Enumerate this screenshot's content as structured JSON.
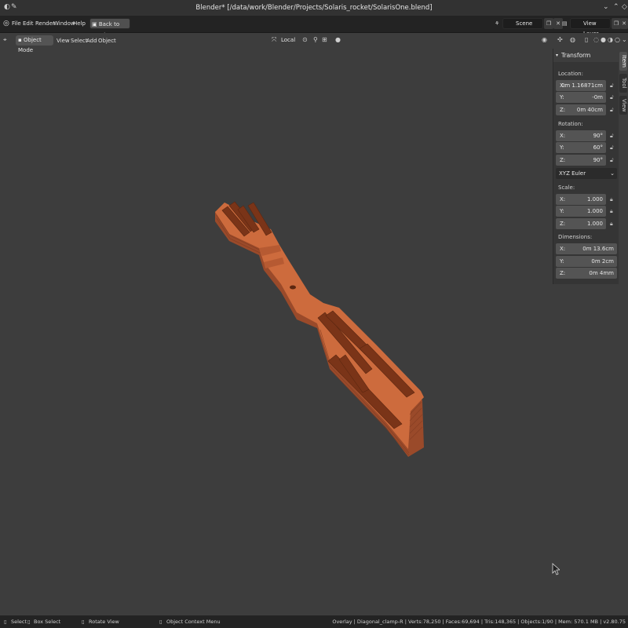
{
  "window": {
    "title": "Blender* [/data/work/Blender/Projects/Solaris_rocket/SolarisOne.blend]"
  },
  "menubar": {
    "items": [
      "File",
      "Edit",
      "Render",
      "Window",
      "Help"
    ],
    "back_button": "Back to Previous",
    "scene": "Scene",
    "view_layer": "View Layer"
  },
  "viewport_header": {
    "mode": "Object Mode",
    "menus": [
      "View",
      "Select",
      "Add",
      "Object"
    ],
    "orientation": "Local"
  },
  "side_tabs": [
    "Item",
    "Tool",
    "View"
  ],
  "transform_panel": {
    "title": "Transform",
    "location_label": "Location:",
    "location": [
      {
        "axis": "X:",
        "value": "0m 1.16871cm"
      },
      {
        "axis": "Y:",
        "value": "-0m"
      },
      {
        "axis": "Z:",
        "value": "0m 40cm"
      }
    ],
    "rotation_label": "Rotation:",
    "rotation": [
      {
        "axis": "X:",
        "value": "90°"
      },
      {
        "axis": "Y:",
        "value": "60°"
      },
      {
        "axis": "Z:",
        "value": "90°"
      }
    ],
    "rotation_mode": "XYZ Euler",
    "scale_label": "Scale:",
    "scale": [
      {
        "axis": "X:",
        "value": "1.000"
      },
      {
        "axis": "Y:",
        "value": "1.000"
      },
      {
        "axis": "Z:",
        "value": "1.000"
      }
    ],
    "dimensions_label": "Dimensions:",
    "dimensions": [
      {
        "axis": "X:",
        "value": "0m 13.6cm"
      },
      {
        "axis": "Y:",
        "value": "0m 2cm"
      },
      {
        "axis": "Z:",
        "value": "0m 4mm"
      }
    ]
  },
  "statusbar": {
    "select": "Select",
    "box_select": "Box Select",
    "rotate_view": "Rotate View",
    "context_menu": "Object Context Menu",
    "stats": "Overlay | Diagonal_clamp-R | Verts:78,250 | Faces:69,694 | Tris:148,365 | Objects:1/90 | Mem: 570.1 MB | v2.80.75"
  },
  "colors": {
    "background": "#3d3d3d",
    "object": "#c8683a",
    "header": "#232323"
  }
}
